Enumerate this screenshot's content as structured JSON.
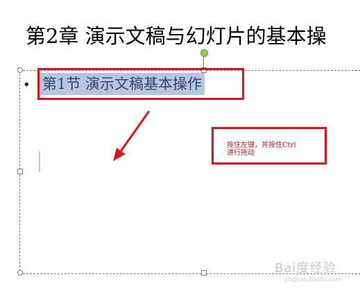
{
  "slide": {
    "title": "第2章 演示文稿与幻灯片的基本操",
    "bullet": "•",
    "selected_text": "第1节 演示文稿基本操作"
  },
  "annotation": {
    "note": "按住左键，并按住Ctrl\n进行拖动",
    "color": "#e0121b"
  },
  "watermark": {
    "main": "Bai度经验",
    "sub": "jingyan.baidu.com"
  }
}
